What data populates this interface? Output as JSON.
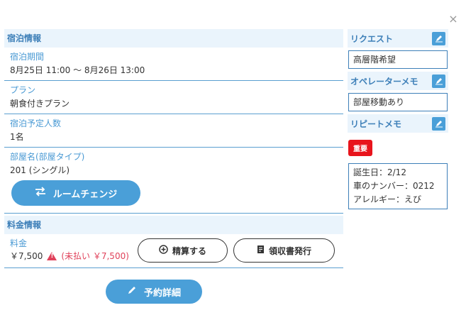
{
  "close_icon": "×",
  "stay_section": {
    "header": "宿泊情報",
    "period_label": "宿泊期間",
    "period_value": "8月25日 11:00 〜 8月26日 13:00",
    "plan_label": "プラン",
    "plan_value": "朝食付きプラン",
    "guests_label": "宿泊予定人数",
    "guests_value": "1名",
    "room_label": "部屋名(部屋タイプ)",
    "room_value": "201 (シングル)",
    "room_change_button": "ルームチェンジ"
  },
  "fee_section": {
    "header": "料金情報",
    "fee_label": "料金",
    "amount": "￥7,500",
    "unpaid_text": "(未払い ￥7,500)",
    "settle_button": "精算する",
    "receipt_button": "領収書発行"
  },
  "detail_button": "予約詳細",
  "memos": {
    "request_title": "リクエスト",
    "request_value": "高層階希望",
    "operator_title": "オペレーターメモ",
    "operator_value": "部屋移動あり",
    "repeat_title": "リピートメモ",
    "important_badge": "重要",
    "repeat_lines": [
      "誕生日：2/12",
      "車のナンバー：0212",
      "アレルギー：えび"
    ]
  },
  "colors": {
    "accent": "#4a9fd8",
    "header_bg": "#eaf4fc",
    "warning": "#e0415a",
    "badge": "#e8141c"
  }
}
